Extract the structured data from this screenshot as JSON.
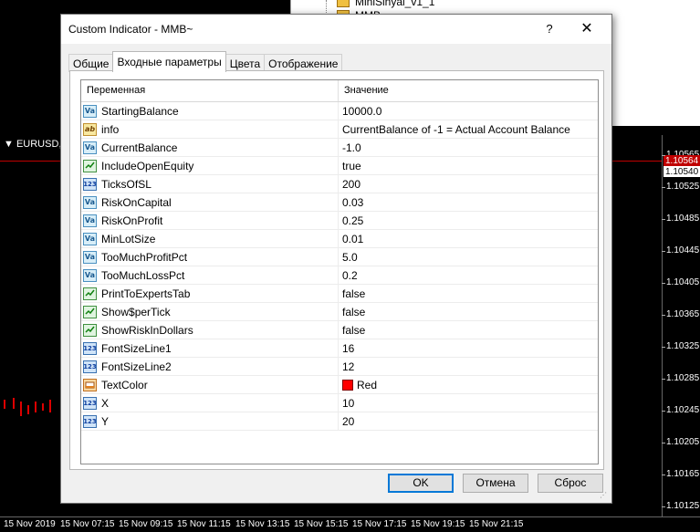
{
  "background": {
    "navigator_items": [
      "MiniSinyal_v1_1",
      "MMB"
    ],
    "chart_title": "EURUSD,M",
    "price_labels": [
      "1.10565",
      "1.10525",
      "1.10485",
      "1.10445",
      "1.10405",
      "1.10365",
      "1.10325",
      "1.10285",
      "1.10245",
      "1.10205",
      "1.10165",
      "1.10125"
    ],
    "price_red": "1.10564",
    "price_white": "1.10540",
    "time_labels": [
      "15 Nov 2019",
      "15 Nov 07:15",
      "15 Nov 09:15",
      "15 Nov 11:15",
      "15 Nov 13:15",
      "15 Nov 15:15",
      "15 Nov 17:15",
      "15 Nov 19:15",
      "15 Nov 21:15"
    ]
  },
  "dialog": {
    "title": "Custom Indicator - MMB~",
    "help_label": "?",
    "close_label": "✕",
    "tabs": [
      {
        "label": "Общие",
        "active": false
      },
      {
        "label": "Входные параметры",
        "active": true
      },
      {
        "label": "Цвета",
        "active": false
      },
      {
        "label": "Отображение",
        "active": false
      }
    ],
    "columns": {
      "variable": "Переменная",
      "value": "Значение"
    },
    "params": [
      {
        "type": "val",
        "icon_text": "Va",
        "name": "StartingBalance",
        "value": "10000.0"
      },
      {
        "type": "ab",
        "icon_text": "ab",
        "name": "info",
        "value": "CurrentBalance of -1 = Actual Account Balance"
      },
      {
        "type": "val",
        "icon_text": "Va",
        "name": "CurrentBalance",
        "value": "-1.0"
      },
      {
        "type": "bool",
        "icon_text": "",
        "name": "IncludeOpenEquity",
        "value": "true"
      },
      {
        "type": "int",
        "icon_text": "123",
        "name": "TicksOfSL",
        "value": "200"
      },
      {
        "type": "val",
        "icon_text": "Va",
        "name": "RiskOnCapital",
        "value": "0.03"
      },
      {
        "type": "val",
        "icon_text": "Va",
        "name": "RiskOnProfit",
        "value": "0.25"
      },
      {
        "type": "val",
        "icon_text": "Va",
        "name": "MinLotSize",
        "value": "0.01"
      },
      {
        "type": "val",
        "icon_text": "Va",
        "name": "TooMuchProfitPct",
        "value": "5.0"
      },
      {
        "type": "val",
        "icon_text": "Va",
        "name": "TooMuchLossPct",
        "value": "0.2"
      },
      {
        "type": "bool",
        "icon_text": "",
        "name": "PrintToExpertsTab",
        "value": "false"
      },
      {
        "type": "bool",
        "icon_text": "",
        "name": "Show$perTick",
        "value": "false"
      },
      {
        "type": "bool",
        "icon_text": "",
        "name": "ShowRiskInDollars",
        "value": "false"
      },
      {
        "type": "int",
        "icon_text": "123",
        "name": "FontSizeLine1",
        "value": "16"
      },
      {
        "type": "int",
        "icon_text": "123",
        "name": "FontSizeLine2",
        "value": "12"
      },
      {
        "type": "color",
        "icon_text": "",
        "name": "TextColor",
        "value": "Red",
        "swatch": "#ff0000"
      },
      {
        "type": "int",
        "icon_text": "123",
        "name": "X",
        "value": "10"
      },
      {
        "type": "int",
        "icon_text": "123",
        "name": "Y",
        "value": "20"
      }
    ],
    "buttons": {
      "ok": "OK",
      "cancel": "Отмена",
      "reset": "Сброс"
    }
  }
}
